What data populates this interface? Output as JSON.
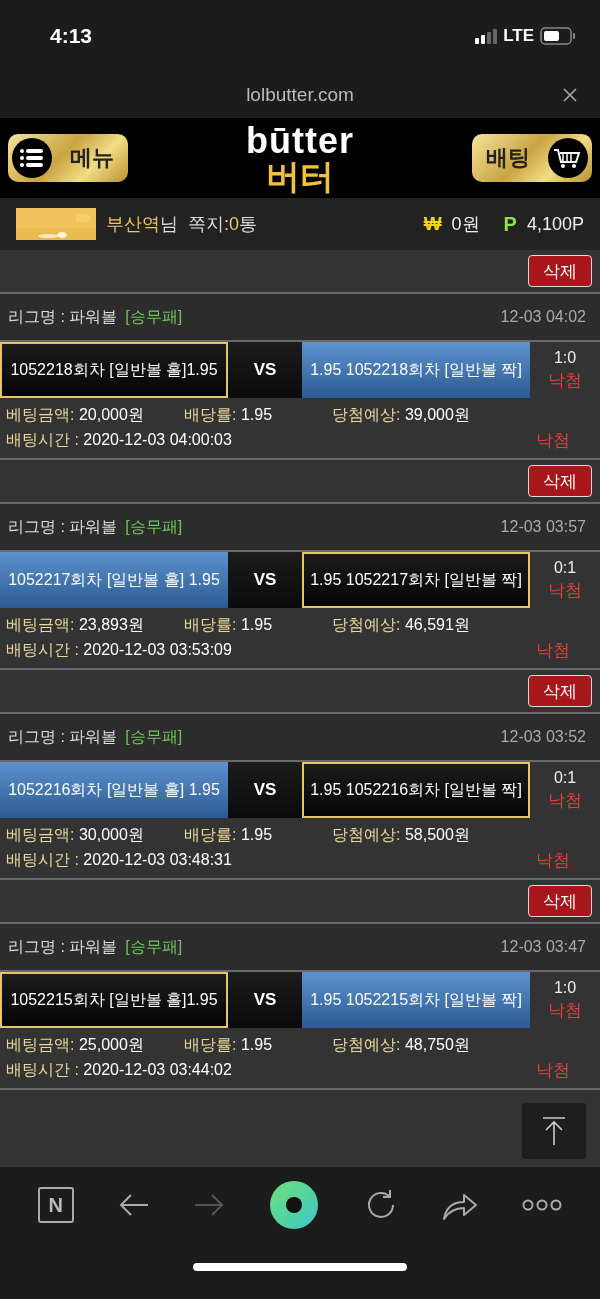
{
  "status_bar": {
    "time": "4:13",
    "network": "LTE"
  },
  "browser": {
    "url": "lolbutter.com"
  },
  "header": {
    "menu_button": "메뉴",
    "logo_top": "būtter",
    "logo_bottom": "버터",
    "bet_button": "배팅"
  },
  "user_bar": {
    "name": "부산역",
    "name_suffix": "님",
    "messages_label": "쪽지:",
    "messages_count": "0",
    "messages_unit": "통",
    "money_symbol": "₩",
    "money": "0원",
    "points_symbol": "P",
    "points": "4,100P"
  },
  "bets": [
    {
      "delete": "삭제",
      "league": "리그명 : 파워볼",
      "bet_type": "[승무패]",
      "time": "12-03 04:02",
      "home": {
        "text": "1052218회차 [일반볼 홀]1.95",
        "selected": true
      },
      "vs": "VS",
      "away": {
        "text": "1.95 1052218회차 [일반볼 짝]",
        "selected": false
      },
      "score": "1:0",
      "result": "낙첨",
      "amount_label": "베팅금액:",
      "amount": "20,000원",
      "odds_label": "배당률:",
      "odds": "1.95",
      "expected_label": "당첨예상:",
      "expected": "39,000원",
      "bet_time_label": "배팅시간 :",
      "bet_time": "2020-12-03 04:00:03",
      "status": "낙첨"
    },
    {
      "delete": "삭제",
      "league": "리그명 : 파워볼",
      "bet_type": "[승무패]",
      "time": "12-03 03:57",
      "home": {
        "text": "1052217회차 [일반볼 홀] 1.95",
        "selected": false
      },
      "vs": "VS",
      "away": {
        "text": "1.95 1052217회차 [일반볼 짝]",
        "selected": true
      },
      "score": "0:1",
      "result": "낙첨",
      "amount_label": "베팅금액:",
      "amount": "23,893원",
      "odds_label": "배당률:",
      "odds": "1.95",
      "expected_label": "당첨예상:",
      "expected": "46,591원",
      "bet_time_label": "배팅시간 :",
      "bet_time": "2020-12-03 03:53:09",
      "status": "낙첨"
    },
    {
      "delete": "삭제",
      "league": "리그명 : 파워볼",
      "bet_type": "[승무패]",
      "time": "12-03 03:52",
      "home": {
        "text": "1052216회차 [일반볼 홀] 1.95",
        "selected": false
      },
      "vs": "VS",
      "away": {
        "text": "1.95 1052216회차 [일반볼 짝]",
        "selected": true
      },
      "score": "0:1",
      "result": "낙첨",
      "amount_label": "베팅금액:",
      "amount": "30,000원",
      "odds_label": "배당률:",
      "odds": "1.95",
      "expected_label": "당첨예상:",
      "expected": "58,500원",
      "bet_time_label": "배팅시간 :",
      "bet_time": "2020-12-03 03:48:31",
      "status": "낙첨"
    },
    {
      "delete": "삭제",
      "league": "리그명 : 파워볼",
      "bet_type": "[승무패]",
      "time": "12-03 03:47",
      "home": {
        "text": "1052215회차 [일반볼 홀]1.95",
        "selected": true
      },
      "vs": "VS",
      "away": {
        "text": "1.95 1052215회차 [일반볼 짝]",
        "selected": false
      },
      "score": "1:0",
      "result": "낙첨",
      "amount_label": "베팅금액:",
      "amount": "25,000원",
      "odds_label": "배당률:",
      "odds": "1.95",
      "expected_label": "당첨예상:",
      "expected": "48,750원",
      "bet_time_label": "배팅시간 :",
      "bet_time": "2020-12-03 03:44:02",
      "status": "낙첨"
    }
  ],
  "toolbar": {
    "home_button": "N"
  }
}
